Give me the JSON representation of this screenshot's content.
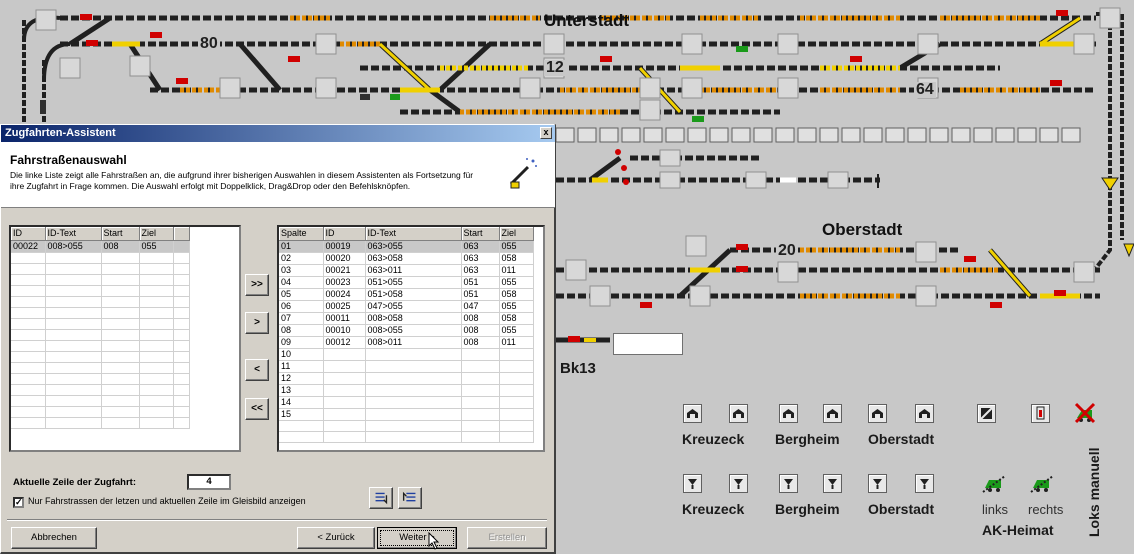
{
  "layout": {
    "title_unterstadt": "Unterstadt",
    "title_oberstadt": "Oberstadt",
    "track_numbers": [
      "80",
      "12",
      "64",
      "20"
    ],
    "block_bk13": "Bk13"
  },
  "panel": {
    "row1_labels": [
      "Kreuzeck",
      "Bergheim",
      "Oberstadt"
    ],
    "row2_labels": [
      "Kreuzeck",
      "Bergheim",
      "Oberstadt"
    ],
    "links_label": "links",
    "rechts_label": "rechts",
    "ak_heimat": "AK-Heimat",
    "loks_manuell": "Loks manuell"
  },
  "dialog": {
    "title": "Zugfahrten-Assistent",
    "close": "x",
    "header_title": "Fahrstraßenauswahl",
    "header_desc": "Die linke Liste zeigt alle Fahrstraßen an, die aufgrund ihrer bisherigen Auswahlen in diesem Assistenten als Fortsetzung für ihre Zugfahrt in Frage kommen. Die Auswahl erfolgt mit Doppelklick, Drag&Drop oder den Befehlsknöpfen.",
    "left_table": {
      "headers": [
        "ID",
        "ID-Text",
        "Start",
        "Ziel"
      ],
      "rows": [
        [
          "00022",
          "008>055",
          "008",
          "055"
        ]
      ]
    },
    "right_table": {
      "headers": [
        "Spalte",
        "ID",
        "ID-Text",
        "Start",
        "Ziel"
      ],
      "rows": [
        [
          "01",
          "00019",
          "063>055",
          "063",
          "055"
        ],
        [
          "02",
          "00020",
          "063>058",
          "063",
          "058"
        ],
        [
          "03",
          "00021",
          "063>011",
          "063",
          "011"
        ],
        [
          "04",
          "00023",
          "051>055",
          "051",
          "055"
        ],
        [
          "05",
          "00024",
          "051>058",
          "051",
          "058"
        ],
        [
          "06",
          "00025",
          "047>055",
          "047",
          "055"
        ],
        [
          "07",
          "00011",
          "008>058",
          "008",
          "058"
        ],
        [
          "08",
          "00010",
          "008>055",
          "008",
          "055"
        ],
        [
          "09",
          "00012",
          "008>011",
          "008",
          "011"
        ],
        [
          "10",
          "",
          "",
          "",
          ""
        ],
        [
          "11",
          "",
          "",
          "",
          ""
        ],
        [
          "12",
          "",
          "",
          "",
          ""
        ],
        [
          "13",
          "",
          "",
          "",
          ""
        ],
        [
          "14",
          "",
          "",
          "",
          ""
        ],
        [
          "15",
          "",
          "",
          "",
          ""
        ]
      ]
    },
    "nav": {
      "add_all": ">>",
      "add_one": ">",
      "remove_one": "<",
      "remove_all": "<<"
    },
    "aktuelle_label": "Aktuelle Zeile der Zugfahrt:",
    "aktuelle_value": "4",
    "checkbox_checked": true,
    "checkbox_mark": "✓",
    "checkbox_label": "Nur Fahrstrassen der letzen und aktuellen Zeile im Gleisbild anzeigen",
    "buttons": {
      "cancel": "Abbrechen",
      "back": "< Zurück",
      "next": "Weiter >",
      "create": "Erstellen"
    }
  },
  "colors": {
    "background": "#c8c8c8",
    "track": "#202020",
    "route_yellow": "#f0d000",
    "route_orange": "#e08a00",
    "title_bar_start": "#0a246a",
    "title_bar_end": "#a6caf0",
    "signal_red": "#d00000",
    "signal_green": "#1a9a1a"
  }
}
